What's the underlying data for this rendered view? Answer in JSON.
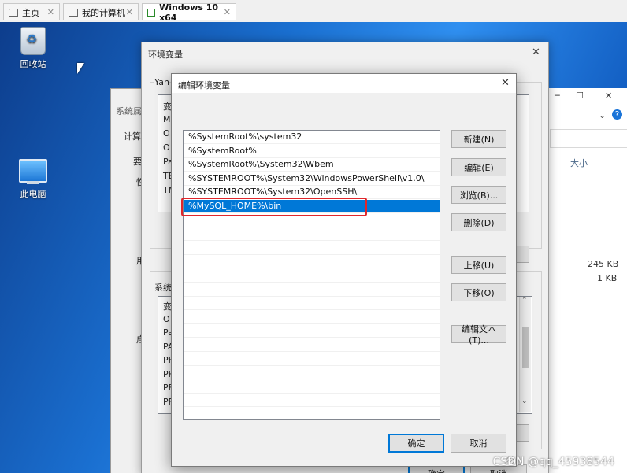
{
  "vm_tabs": [
    {
      "label": "主页"
    },
    {
      "label": "我的计算机"
    },
    {
      "label": "Windows 10 x64"
    }
  ],
  "desktop": {
    "recycle_bin_label": "回收站",
    "this_pc_label": "此电脑"
  },
  "system_properties": {
    "title": "系统属",
    "tab_label": "计算",
    "frag_1": "要",
    "frag_2": "性",
    "frag_3": "用",
    "frag_4": "启"
  },
  "explorer": {
    "minimize": "─",
    "maximize": "☐",
    "close": "✕",
    "size_header": "大小",
    "sizes": [
      "245 KB",
      "1 KB"
    ]
  },
  "env_vars": {
    "title": "环境变量",
    "close": "✕",
    "user_section_fragment": "Yan",
    "user_rows": [
      "变",
      "M",
      "O",
      "O",
      "Pa",
      "TE",
      "TM"
    ],
    "system_section_label": "系统",
    "system_rows": [
      "变",
      "O",
      "Pa",
      "PA",
      "PF",
      "PF",
      "PF",
      "PF"
    ],
    "ok_label": "确定",
    "cancel_label": "取消"
  },
  "edit_dialog": {
    "title": "编辑环境变量",
    "close": "✕",
    "paths": [
      "%SystemRoot%\\system32",
      "%SystemRoot%",
      "%SystemRoot%\\System32\\Wbem",
      "%SYSTEMROOT%\\System32\\WindowsPowerShell\\v1.0\\",
      "%SYSTEMROOT%\\System32\\OpenSSH\\",
      "%MySQL_HOME%\\bin"
    ],
    "selected_index": 5,
    "buttons": {
      "new": "新建(N)",
      "edit": "编辑(E)",
      "browse": "浏览(B)...",
      "delete": "删除(D)",
      "move_up": "上移(U)",
      "move_down": "下移(O)",
      "edit_text": "编辑文本(T)...",
      "ok": "确定",
      "cancel": "取消"
    }
  },
  "watermark": "CSDN @qq_45938544",
  "colors": {
    "selection": "#0078d7",
    "highlight_box": "#e0262b",
    "desktop_blue": "#1a6fd0"
  }
}
